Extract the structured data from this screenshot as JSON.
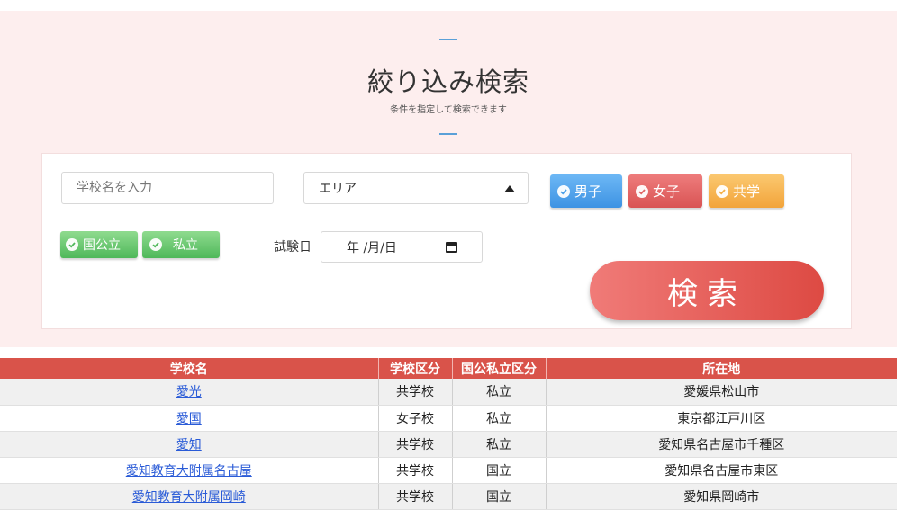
{
  "header": {
    "title": "絞り込み検索",
    "subtitle": "条件を指定して検索できます"
  },
  "form": {
    "school_name_placeholder": "学校名を入力",
    "area_select_value": "エリア",
    "gender_chips": [
      {
        "label": "男子",
        "color": "#4a9fe8"
      },
      {
        "label": "女子",
        "color": "#e06363"
      },
      {
        "label": "共学",
        "color": "#f5b047"
      }
    ],
    "type_chips": [
      {
        "label": "国公立",
        "color": "#5cc068"
      },
      {
        "label": "私立",
        "color": "#5cc068"
      }
    ],
    "exam_date_label": "試験日",
    "exam_date_value": "年 /月/日",
    "search_button_label": "検索"
  },
  "table": {
    "headers": [
      "学校名",
      "学校区分",
      "国公私立区分",
      "所在地"
    ],
    "rows": [
      {
        "name": "愛光",
        "kubun": "共学校",
        "koku": "私立",
        "location": "愛媛県松山市"
      },
      {
        "name": "愛国",
        "kubun": "女子校",
        "koku": "私立",
        "location": "東京都江戸川区"
      },
      {
        "name": "愛知",
        "kubun": "共学校",
        "koku": "私立",
        "location": "愛知県名古屋市千種区"
      },
      {
        "name": "愛知教育大附属名古屋",
        "kubun": "共学校",
        "koku": "国立",
        "location": "愛知県名古屋市東区"
      },
      {
        "name": "愛知教育大附属岡崎",
        "kubun": "共学校",
        "koku": "国立",
        "location": "愛知県岡崎市"
      }
    ]
  },
  "colors": {
    "panel_bg": "#fdeeee",
    "accent_red": "#d9534a",
    "link_blue": "#2a5bd7"
  }
}
